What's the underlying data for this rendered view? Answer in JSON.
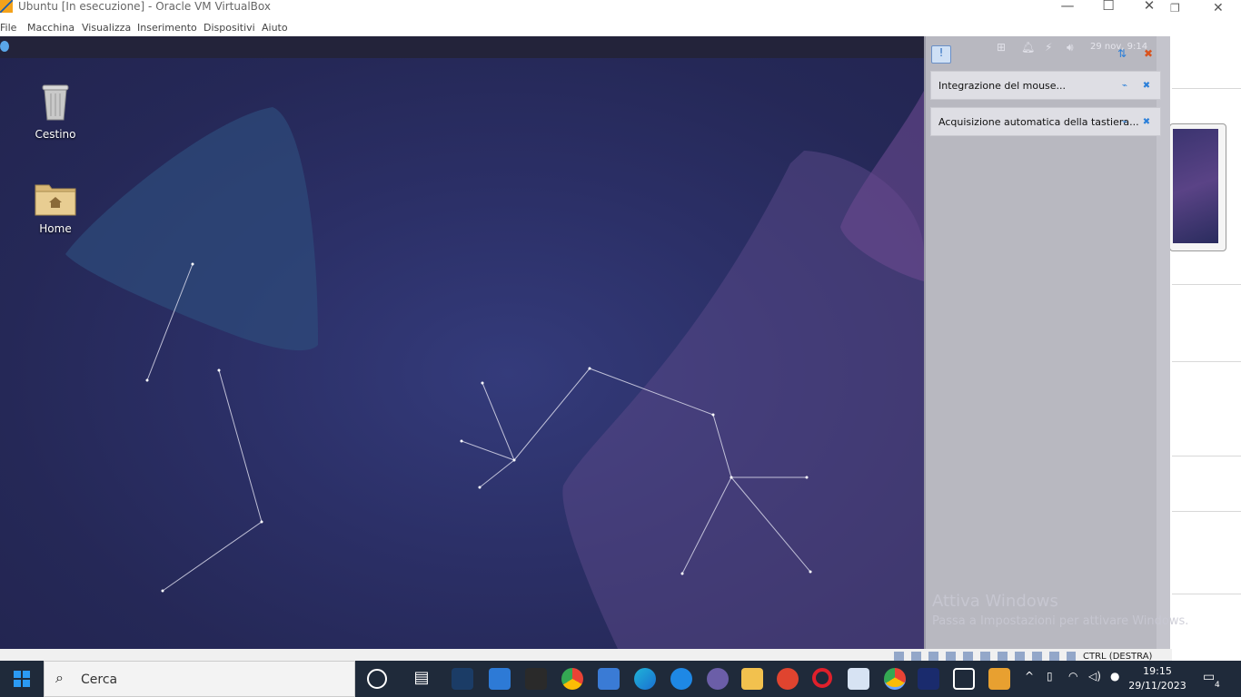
{
  "window": {
    "title": "Ubuntu [In esecuzione] - Oracle VM VirtualBox",
    "minimize": "—",
    "maximize": "☐",
    "close": "✕"
  },
  "menu": [
    "File",
    "Macchina",
    "Visualizza",
    "Inserimento",
    "Dispositivi",
    "Aiuto"
  ],
  "desktop": {
    "icons": [
      {
        "label": "Cestino",
        "icon": "trash-icon"
      },
      {
        "label": "Home",
        "icon": "home-folder-icon"
      }
    ]
  },
  "topbar": {
    "clock": "29 nov, 9:14"
  },
  "notifications": [
    {
      "text": "Integrazione del mouse..."
    },
    {
      "text": "Acquisizione automatica della tastiera..."
    }
  ],
  "statusbar": {
    "host_key": "CTRL (DESTRA)"
  },
  "watermark": {
    "line1": "Attiva Windows",
    "line2": "Passa a Impostazioni per attivare Windows."
  },
  "taskbar": {
    "search_placeholder": "Cerca",
    "time": "19:15",
    "date": "29/11/2023",
    "notif_count": "4"
  },
  "colors": {
    "guest_bg": "#2b2f66",
    "taskbar": "#1f2a3a",
    "notif_panel": "#b8b8c0"
  }
}
